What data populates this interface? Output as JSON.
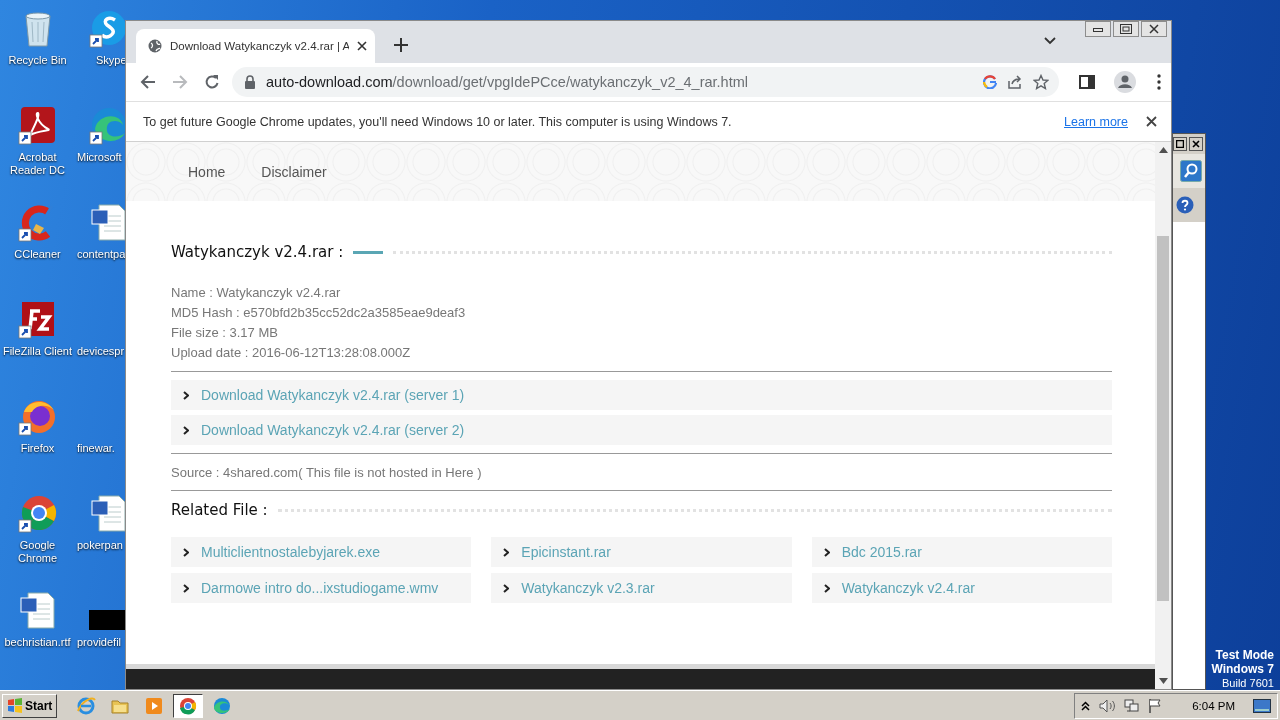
{
  "desktop": {
    "icons": [
      {
        "label": "Recycle Bin",
        "kind": "recycle",
        "shortcut": false
      },
      {
        "label": "Acrobat Reader DC",
        "kind": "acrobat",
        "shortcut": true
      },
      {
        "label": "CCleaner",
        "kind": "ccleaner",
        "shortcut": true
      },
      {
        "label": "FileZilla Client",
        "kind": "filezilla",
        "shortcut": true
      },
      {
        "label": "Firefox",
        "kind": "firefox",
        "shortcut": true
      },
      {
        "label": "Google Chrome",
        "kind": "chrome",
        "shortcut": true
      },
      {
        "label": "bechristian.rtf",
        "kind": "word",
        "shortcut": false
      }
    ],
    "icons_column_2": [
      {
        "label": "Skype",
        "kind": "skype",
        "shortcut": true
      },
      {
        "label": "Microsoft",
        "kind": "edge",
        "shortcut": true
      },
      {
        "label": "contentpa",
        "kind": "word",
        "shortcut": false
      },
      {
        "label": "devicespr",
        "kind": "none"
      },
      {
        "label": "finewar.",
        "kind": "none"
      },
      {
        "label": "pokerpan",
        "kind": "word",
        "shortcut": false
      },
      {
        "label": "providefil",
        "kind": "dark",
        "shortcut": false
      }
    ],
    "test_mode": [
      "Test Mode",
      "Windows 7",
      "Build 7601"
    ]
  },
  "browser": {
    "tabs": [
      {
        "title": "Download Watykanczyk v2.4.rar | A",
        "selected": true
      }
    ],
    "nav_buttons": [
      {
        "kind": "back",
        "disabled": false
      },
      {
        "kind": "forward",
        "disabled": true
      },
      {
        "kind": "reload",
        "disabled": false
      }
    ],
    "address": {
      "host": "auto-download.com",
      "path": "/download/get/vpgIdePCce/watykanczyk_v2_4_rar.html"
    },
    "infobar": {
      "message": "To get future Google Chrome updates, you'll need Windows 10 or later. This computer is using Windows 7.",
      "link": "Learn more"
    }
  },
  "page": {
    "nav": [
      "Home",
      "Disclaimer"
    ],
    "title": "Watykanczyk v2.4.rar :",
    "details": [
      "Name : Watykanczyk v2.4.rar",
      "MD5 Hash : e570bfd2b35cc52dc2a3585eae9deaf3",
      "File size : 3.17 MB",
      "Upload date : 2016-06-12T13:28:08.000Z"
    ],
    "downloads": [
      "Download Watykanczyk v2.4.rar (server 1)",
      "Download Watykanczyk v2.4.rar (server 2)"
    ],
    "source": "Source : 4shared.com( This file is not hosted in Here )",
    "related_title": "Related File :",
    "related": [
      "Multiclientnostalebyjarek.exe",
      "Epicinstant.rar",
      "Bdc 2015.rar",
      "Darmowe intro do...ixstudiogame.wmv",
      "Watykanczyk v2.3.rar",
      "Watykanczyk v2.4.rar"
    ]
  },
  "taskbar": {
    "start": "Start",
    "apps": [
      {
        "kind": "ie",
        "selected": false
      },
      {
        "kind": "explorer",
        "selected": false
      },
      {
        "kind": "media",
        "selected": false
      },
      {
        "kind": "chrome",
        "selected": true
      },
      {
        "kind": "edge",
        "selected": false
      }
    ],
    "clock": "6:04 PM"
  }
}
